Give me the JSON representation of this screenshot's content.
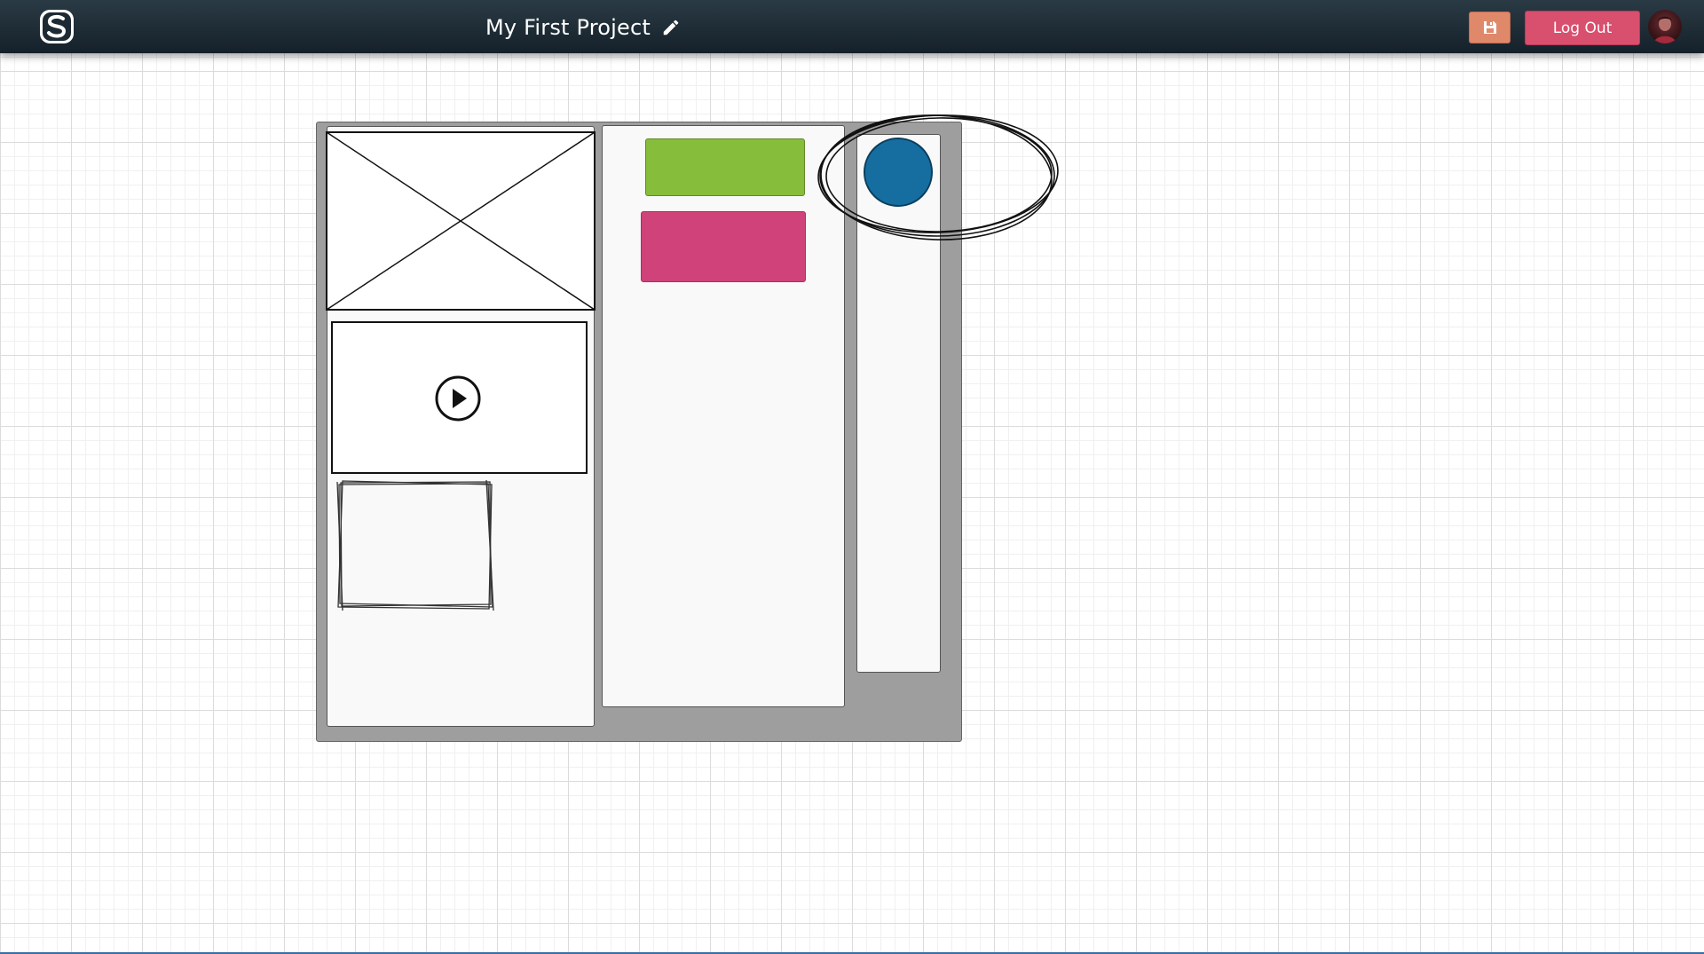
{
  "header": {
    "project_title": "My First Project",
    "logout_label": "Log Out",
    "logo_icon": "app-logo-icon",
    "edit_icon": "pencil-icon",
    "save_icon": "floppy-disk-icon",
    "avatar_icon": "user-avatar"
  },
  "canvas": {
    "grid": true,
    "elements": [
      {
        "type": "container",
        "name": "outer-frame"
      },
      {
        "type": "panel",
        "name": "left-column"
      },
      {
        "type": "image-placeholder",
        "name": "image-placeholder"
      },
      {
        "type": "video-placeholder",
        "name": "video-placeholder",
        "icon": "play-icon"
      },
      {
        "type": "sketch-rectangle",
        "name": "sketch-rectangle"
      },
      {
        "type": "panel",
        "name": "middle-column"
      },
      {
        "type": "button-shape",
        "name": "green-button",
        "color": "#86bd3b"
      },
      {
        "type": "button-shape",
        "name": "pink-button",
        "color": "#cf427a"
      },
      {
        "type": "panel",
        "name": "right-column"
      },
      {
        "type": "circle",
        "name": "blue-circle",
        "color": "#166ea0"
      },
      {
        "type": "sketch-ellipse",
        "name": "sketch-ellipse"
      }
    ]
  },
  "colors": {
    "topbar": "#1c2b34",
    "save_button": "#e0896a",
    "logout_button": "#d94f6e",
    "green": "#86bd3b",
    "pink": "#cf427a",
    "blue": "#166ea0"
  }
}
